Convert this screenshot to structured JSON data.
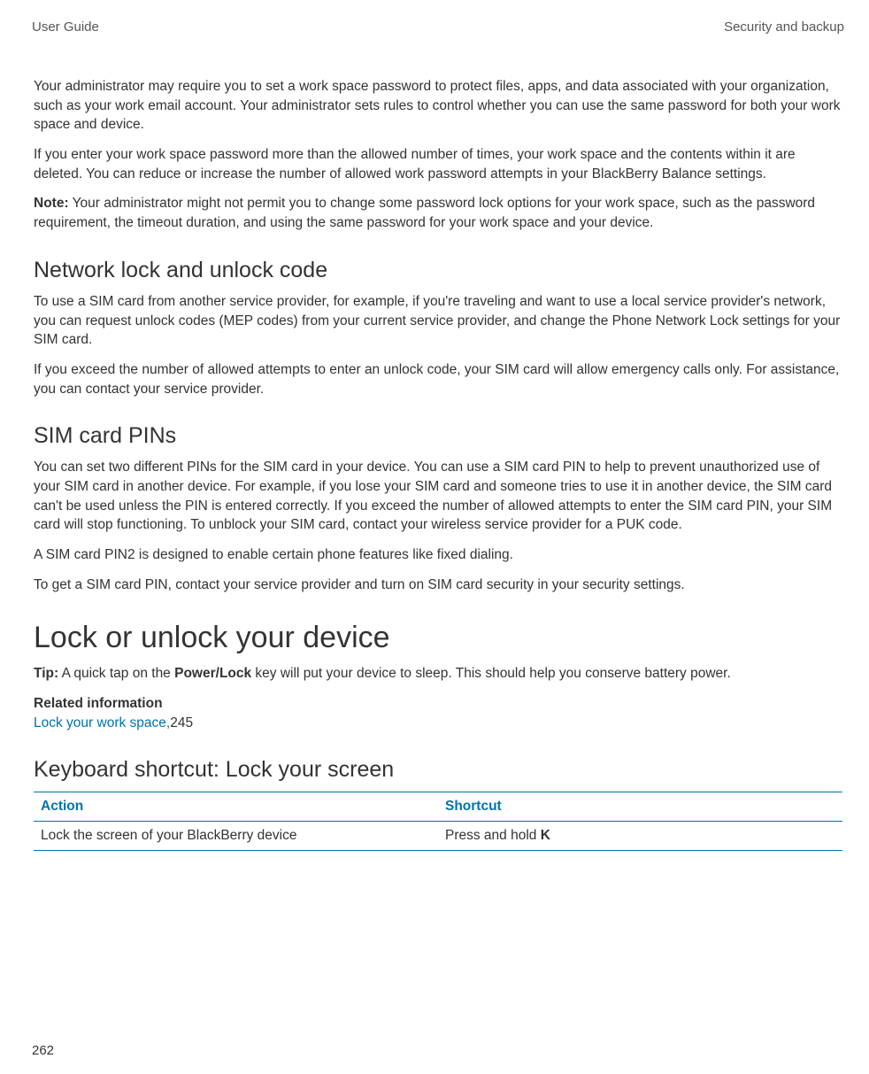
{
  "header": {
    "left": "User Guide",
    "right": "Security and backup"
  },
  "intro": {
    "p1": "Your administrator may require you to set a work space password to protect files, apps, and data associated with your organization, such as your work email account. Your administrator sets rules to control whether you can use the same password for both your work space and device.",
    "p2": "If you enter your work space password more than the allowed number of times, your work space and the contents within it are deleted. You can reduce or increase the number of allowed work password attempts in your BlackBerry Balance settings.",
    "note_label": "Note:",
    "note_text": " Your administrator might not permit you to change some password lock options for your work space, such as the password requirement, the timeout duration, and using the same password for your work space and your device."
  },
  "network": {
    "title": "Network lock and unlock code",
    "p1": "To use a SIM card from another service provider, for example, if you're traveling and want to use a local service provider's network, you can request unlock codes (MEP codes) from your current service provider, and change the Phone Network Lock settings for your SIM card.",
    "p2": "If you exceed the number of allowed attempts to enter an unlock code, your SIM card will allow emergency calls only. For assistance, you can contact your service provider."
  },
  "sim": {
    "title": "SIM card PINs",
    "p1": "You can set two different PINs for the SIM card in your device. You can use a SIM card PIN to help to prevent unauthorized use of your SIM card in another device. For example, if you lose your SIM card and someone tries to use it in another device, the SIM card can't be used unless the PIN is entered correctly. If you exceed the number of allowed attempts to enter the SIM card PIN, your SIM card will stop functioning. To unblock your SIM card, contact your wireless service provider for a PUK code.",
    "p2": "A SIM card PIN2 is designed to enable certain phone features like fixed dialing.",
    "p3": "To get a SIM card PIN, contact your service provider and turn on SIM card security in your security settings."
  },
  "lock": {
    "title": "Lock or unlock your device",
    "tip_label": "Tip:",
    "tip_text_before": " A quick tap on the ",
    "tip_key": "Power/Lock",
    "tip_text_after": " key will put your device to sleep. This should help you conserve battery power.",
    "related_label": "Related information",
    "related_link": "Lock your work space,",
    "related_page": "245"
  },
  "shortcut": {
    "title": "Keyboard shortcut: Lock your screen",
    "col1": "Action",
    "col2": "Shortcut",
    "row1_action": "Lock the screen of your BlackBerry device",
    "row1_shortcut_prefix": "Press and hold ",
    "row1_shortcut_key": "K"
  },
  "page_number": "262"
}
